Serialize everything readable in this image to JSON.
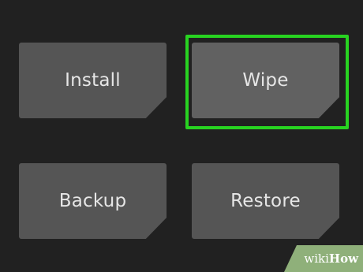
{
  "menu": {
    "tiles": [
      {
        "label": "Install"
      },
      {
        "label": "Wipe"
      },
      {
        "label": "Backup"
      },
      {
        "label": "Restore"
      }
    ]
  },
  "colors": {
    "background": "#212121",
    "tile": "#555555",
    "selected_tile": "#616161",
    "highlight": "#28d321",
    "watermark": "#8fb07a"
  },
  "watermark": {
    "wiki": "wiki",
    "how": "How"
  }
}
